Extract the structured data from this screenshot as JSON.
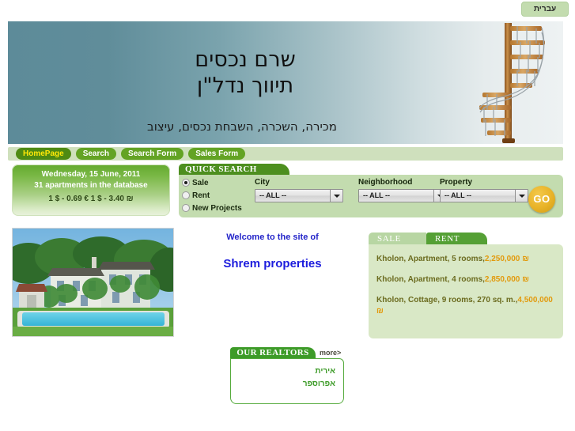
{
  "topbar": {
    "language_button": "עברית"
  },
  "banner": {
    "title_line1": "שרם נכסים",
    "title_line2": "תיווך נדל\"ן",
    "subtitle": "מכירה, השכרה, השבחת נכסים, עיצוב",
    "image_alt": "spiral-staircase",
    "gradient_from": "#5d8b99",
    "gradient_to": "#eef2f3"
  },
  "nav": {
    "items": [
      {
        "label": "HomePage",
        "active": true
      },
      {
        "label": "Search",
        "active": false
      },
      {
        "label": "Search Form",
        "active": false
      },
      {
        "label": "Sales Form",
        "active": false
      }
    ],
    "active_color": "#ffe808",
    "button_color": "#63a324"
  },
  "infobox": {
    "date": "Wednesday, 15 June, 2011",
    "count": "31 apartments in the database",
    "rates": "1 $ - 0.69 €   1 $ - 3.40 ₪"
  },
  "quick_search": {
    "title": "QUICK SEARCH",
    "radios": [
      {
        "label": "Sale",
        "selected": true
      },
      {
        "label": "Rent",
        "selected": false
      },
      {
        "label": "New Projects",
        "selected": false
      }
    ],
    "fields": [
      {
        "label": "City",
        "value": "-- ALL --"
      },
      {
        "label": "Neighborhood",
        "value": "-- ALL --"
      },
      {
        "label": "Property",
        "value": "-- ALL --"
      }
    ],
    "go_label": "GO",
    "go_color": "#e9b429"
  },
  "photo": {
    "alt": "villa-with-pool-photo"
  },
  "welcome": {
    "line1": "Welcome to the site of",
    "line2": "Shrem properties",
    "color": "#1d1ddd"
  },
  "listings": {
    "tabs": [
      {
        "label": "SALE",
        "active": true
      },
      {
        "label": "RENT",
        "active": false
      }
    ],
    "items": [
      {
        "description": "Kholon, Apartment, 5 rooms,",
        "price": "2,250,000 ₪"
      },
      {
        "description": "Kholon, Apartment, 4 rooms,",
        "price": "2,850,000 ₪"
      },
      {
        "description": "Kholon, Cottage, 9 rooms, 270 sq. m.,",
        "price": "4,500,000 ₪"
      }
    ],
    "price_color": "#e29a0d"
  },
  "realtors": {
    "title": "OUR REALTORS",
    "more_label": "more>",
    "names": [
      "אירית",
      "אפרוספר"
    ],
    "name_color": "#3d9b28"
  }
}
